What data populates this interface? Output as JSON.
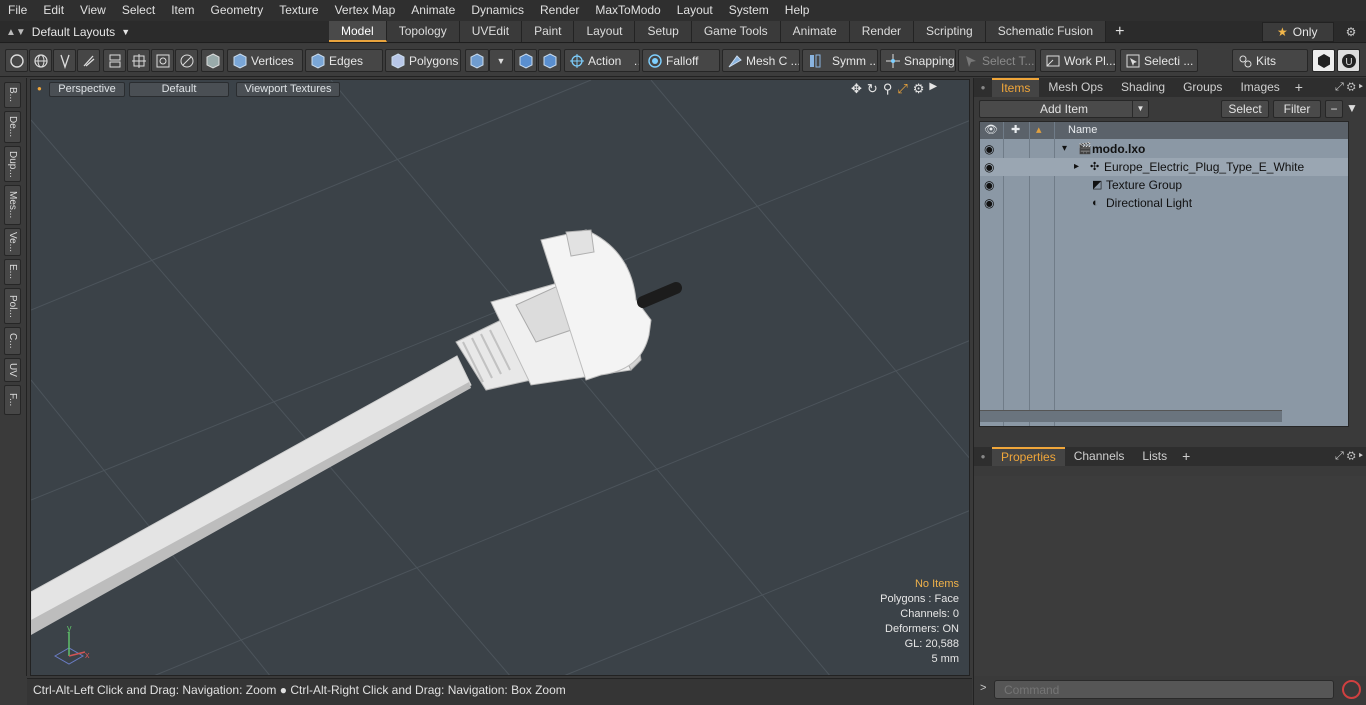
{
  "menu": [
    "File",
    "Edit",
    "View",
    "Select",
    "Item",
    "Geometry",
    "Texture",
    "Vertex Map",
    "Animate",
    "Dynamics",
    "Render",
    "MaxToModo",
    "Layout",
    "System",
    "Help"
  ],
  "layout": {
    "label": "Default Layouts"
  },
  "tabs": [
    "Model",
    "Topology",
    "UVEdit",
    "Paint",
    "Layout",
    "Setup",
    "Game Tools",
    "Animate",
    "Render",
    "Scripting",
    "Schematic Fusion"
  ],
  "active_tab": "Model",
  "only_label": "Only",
  "toolbar": {
    "vertices": "Vertices",
    "edges": "Edges",
    "polygons": "Polygons",
    "action": "Action",
    "falloff": "Falloff",
    "mesh": "Mesh C ...",
    "symm": "Symm ...",
    "snapping": "Snapping",
    "select_t": "Select T...",
    "workpl": "Work Pl...",
    "selecti": "Selecti ...",
    "kits": "Kits"
  },
  "left_strip": [
    "B...",
    "De...",
    "Dup...",
    "Mes...",
    "Ve...",
    "E...",
    "Pol...",
    "C...",
    "UV",
    "F..."
  ],
  "viewport": {
    "perspective": "Perspective",
    "default": "Default",
    "textures": "Viewport Textures",
    "info": {
      "no_items": "No Items",
      "polygons": "Polygons : Face",
      "channels": "Channels: 0",
      "deformers": "Deformers: ON",
      "gl": "GL: 20,588",
      "units": "5 mm"
    }
  },
  "status": "Ctrl-Alt-Left Click and Drag: Navigation: Zoom ● Ctrl-Alt-Right Click and Drag: Navigation: Box Zoom",
  "items_panel": {
    "tabs": [
      "Items",
      "Mesh Ops",
      "Shading",
      "Groups",
      "Images"
    ],
    "add_item": "Add Item",
    "select": "Select",
    "filter": "Filter",
    "name_col": "Name",
    "rows": [
      {
        "label": "modo.lxo"
      },
      {
        "label": "Europe_Electric_Plug_Type_E_White"
      },
      {
        "label": "Texture Group"
      },
      {
        "label": "Directional Light"
      }
    ]
  },
  "props_panel": {
    "tabs": [
      "Properties",
      "Channels",
      "Lists"
    ]
  },
  "command_placeholder": "Command",
  "colors": {
    "accent": "#f0a63a",
    "viewport_bg": "#3b4248",
    "list_bg": "#8b98a5"
  }
}
